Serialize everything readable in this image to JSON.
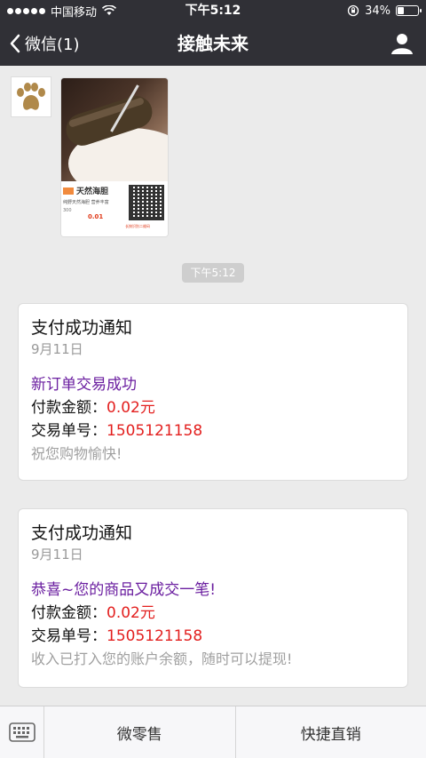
{
  "status_bar": {
    "carrier": "中国移动",
    "time": "下午5:12",
    "battery": "34%",
    "battery_level": 0.34
  },
  "nav": {
    "back_label": "微信(1)",
    "title": "接触未来"
  },
  "image_message": {
    "product_title": "天然海胆",
    "product_subtitle": "纯野天然海胆 营养丰富",
    "quantity": "300",
    "price": "0.01",
    "qr_label": "长按识别二维码"
  },
  "timestamp": "下午5:12",
  "notices": [
    {
      "title": "支付成功通知",
      "date": "9月11日",
      "headline": "新订单交易成功",
      "amount_label": "付款金额：",
      "amount_value": "0.02元",
      "order_label": "交易单号：",
      "order_value": "1505121158",
      "footer": "祝您购物愉快!"
    },
    {
      "title": "支付成功通知",
      "date": "9月11日",
      "headline": "恭喜~您的商品又成交一笔!",
      "amount_label": "付款金额：",
      "amount_value": "0.02元",
      "order_label": "交易单号：",
      "order_value": "1505121158",
      "footer": "收入已打入您的账户余额，随时可以提现!"
    }
  ],
  "bottom_menu": {
    "items": [
      "微零售",
      "快捷直销"
    ]
  },
  "colors": {
    "header_bg": "#303036",
    "chat_bg": "#ebebeb",
    "headline": "#6b1fa0",
    "value_red": "#e3201f"
  }
}
